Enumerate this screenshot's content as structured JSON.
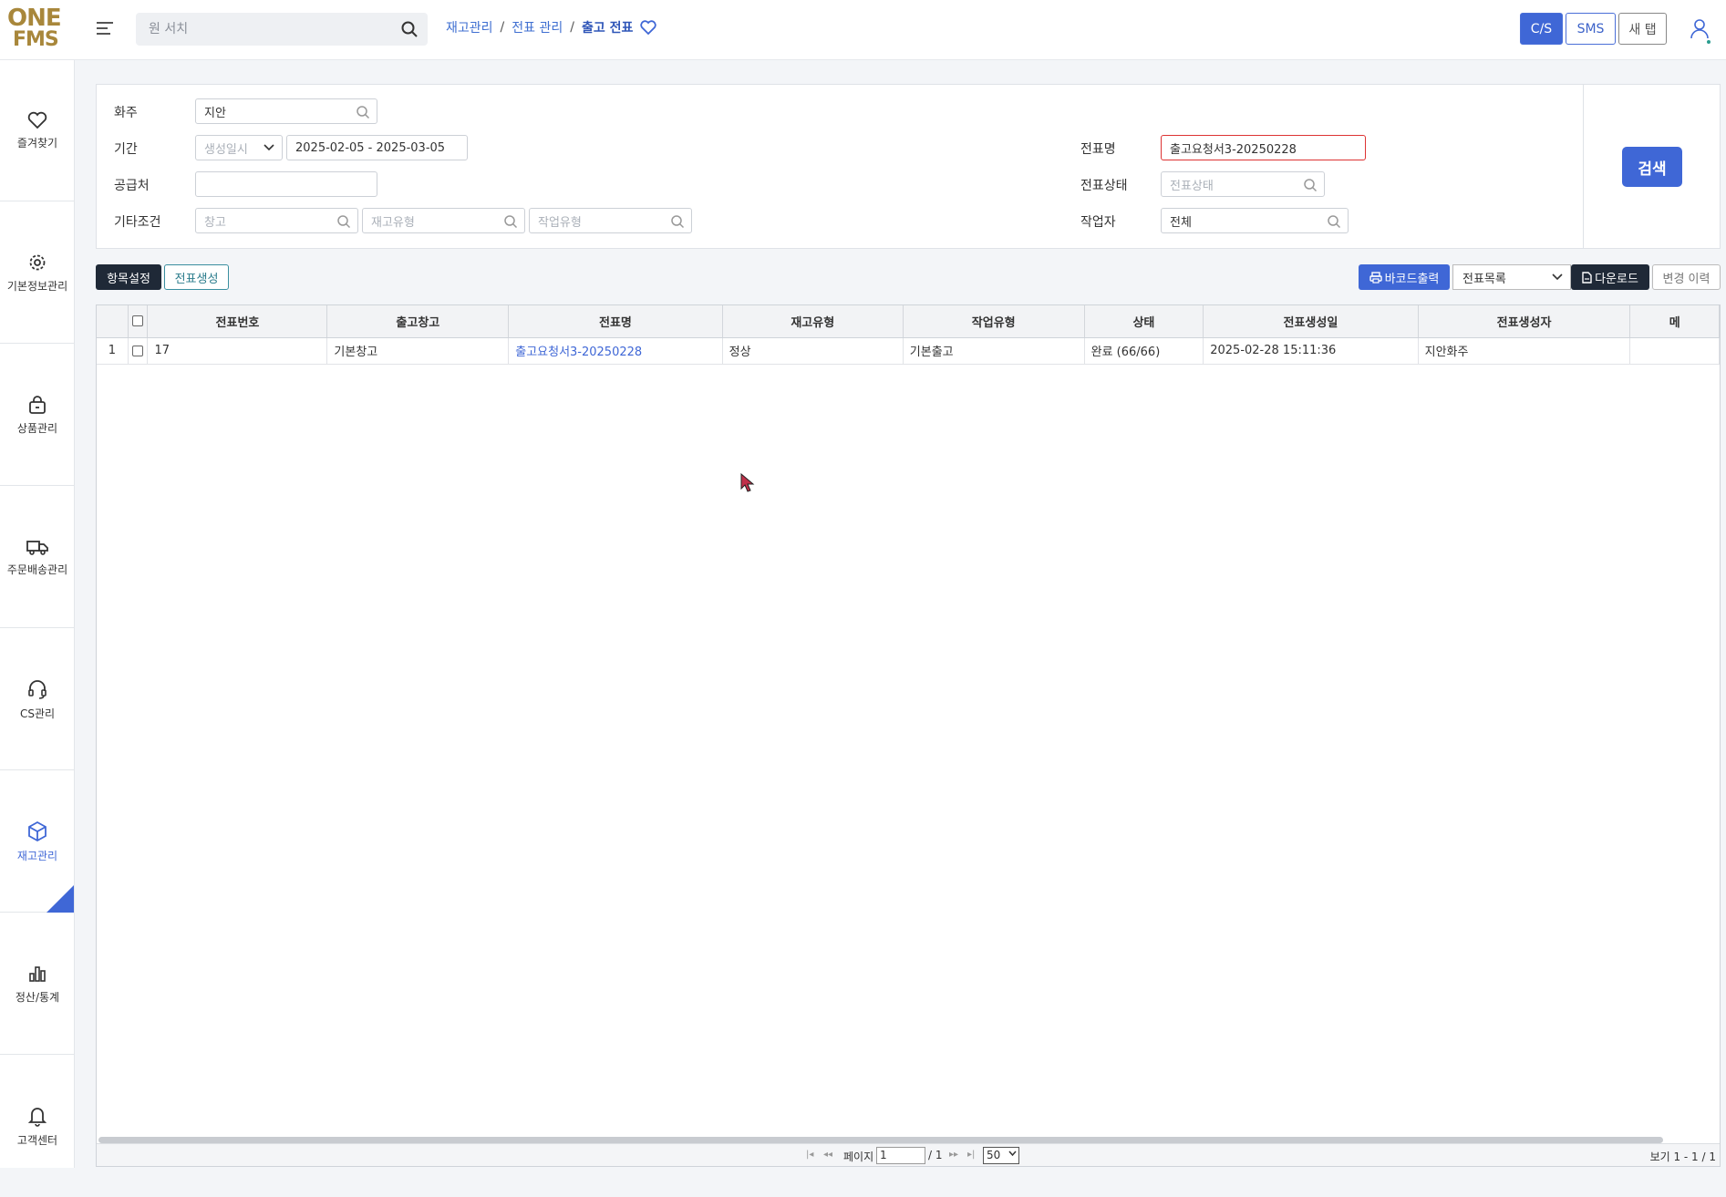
{
  "header": {
    "logo_line1": "ONE",
    "logo_line2": "FMS",
    "search_placeholder": "원 서치",
    "breadcrumb": [
      "재고관리",
      "전표 관리",
      "출고 전표"
    ],
    "btn_cs": "C/S",
    "btn_sms": "SMS",
    "btn_newtab": "새 탭"
  },
  "sidebar": {
    "items": [
      {
        "label": "즐겨찾기",
        "icon": "heart-icon"
      },
      {
        "label": "기본정보관리",
        "icon": "gear-icon"
      },
      {
        "label": "상품관리",
        "icon": "bag-icon"
      },
      {
        "label": "주문배송관리",
        "icon": "truck-icon"
      },
      {
        "label": "CS관리",
        "icon": "headset-icon"
      },
      {
        "label": "재고관리",
        "icon": "cube-icon",
        "active": true
      },
      {
        "label": "정산/통계",
        "icon": "bar-chart-icon"
      },
      {
        "label": "고객센터",
        "icon": "bell-icon"
      }
    ],
    "accent": "#3f67d6"
  },
  "filter": {
    "owner_label": "화주",
    "owner_value": "지안",
    "period_label": "기간",
    "period_type": "생성일시",
    "period_range": "2025-02-05 - 2025-03-05",
    "supplier_label": "공급처",
    "supplier_value": "",
    "etc_label": "기타조건",
    "warehouse_placeholder": "창고",
    "stocktype_placeholder": "재고유형",
    "worktype_placeholder": "작업유형",
    "slip_name_label": "전표명",
    "slip_name_value": "출고요청서3-20250228",
    "slip_status_label": "전표상태",
    "slip_status_placeholder": "전표상태",
    "worker_label": "작업자",
    "worker_value": "전체",
    "search_btn": "검색"
  },
  "toolbar": {
    "column_settings": "항목설정",
    "create_slip": "전표생성",
    "barcode_print": "바코드출력",
    "list_select": "전표목록",
    "download": "다운로드",
    "change_history": "변경 이력"
  },
  "table": {
    "columns": [
      "전표번호",
      "출고창고",
      "전표명",
      "재고유형",
      "작업유형",
      "상태",
      "전표생성일",
      "전표생성자",
      "메"
    ],
    "rows": [
      {
        "rownum": "1",
        "slip_no": "17",
        "warehouse": "기본창고",
        "slip_name": "출고요청서3-20250228",
        "stock_type": "정상",
        "work_type": "기본출고",
        "status": "완료 (66/66)",
        "created_at": "2025-02-28 15:11:36",
        "creator": "지안화주",
        "memo": ""
      }
    ]
  },
  "pager": {
    "page_label": "페이지",
    "page_value": "1",
    "total_pages": "/ 1",
    "page_size": "50",
    "view_info": "보기 1 - 1 / 1"
  }
}
